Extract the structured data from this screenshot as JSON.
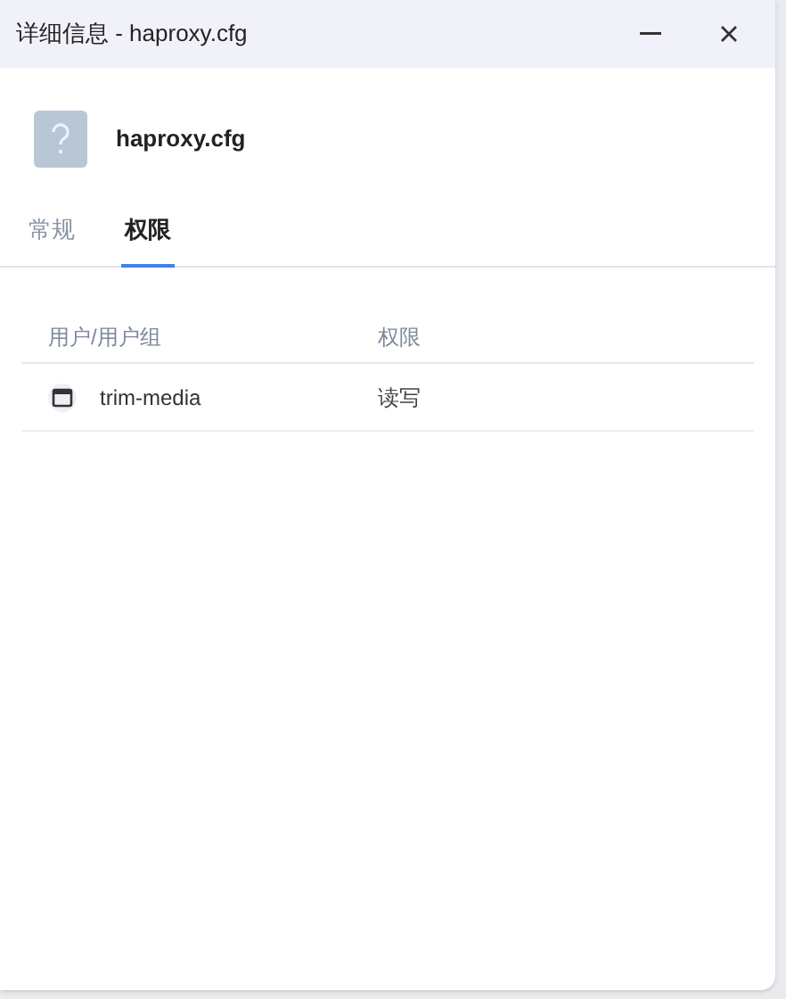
{
  "window": {
    "title": "详细信息 - haproxy.cfg"
  },
  "file": {
    "name": "haproxy.cfg"
  },
  "tabs": [
    {
      "label": "常规",
      "selected": false
    },
    {
      "label": "权限",
      "selected": true
    }
  ],
  "table": {
    "columns": [
      "用户/用户组",
      "权限"
    ],
    "rows": [
      {
        "name": "trim-media",
        "permission": "读写"
      }
    ]
  }
}
